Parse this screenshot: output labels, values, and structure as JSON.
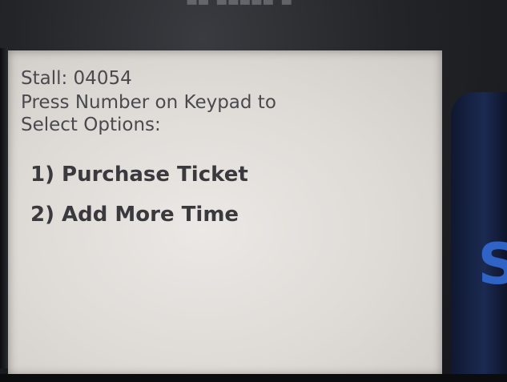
{
  "device": {
    "brand_text": "",
    "screen": {
      "stall_line": "Stall: 04054",
      "instruction_line1": "Press Number on Keypad to",
      "instruction_line2": "Select Options:",
      "menu": [
        {
          "key": "1)",
          "label": "Purchase Ticket",
          "text": "1) Purchase Ticket"
        },
        {
          "key": "2)",
          "label": "Add More Time",
          "text": "2) Add More Time"
        }
      ]
    },
    "side_letter": "S"
  },
  "colors": {
    "screen_bg": "#e6e2de",
    "text": "#4a4a4e",
    "bezel": "#232428",
    "side_accent": "#2f63c6"
  }
}
